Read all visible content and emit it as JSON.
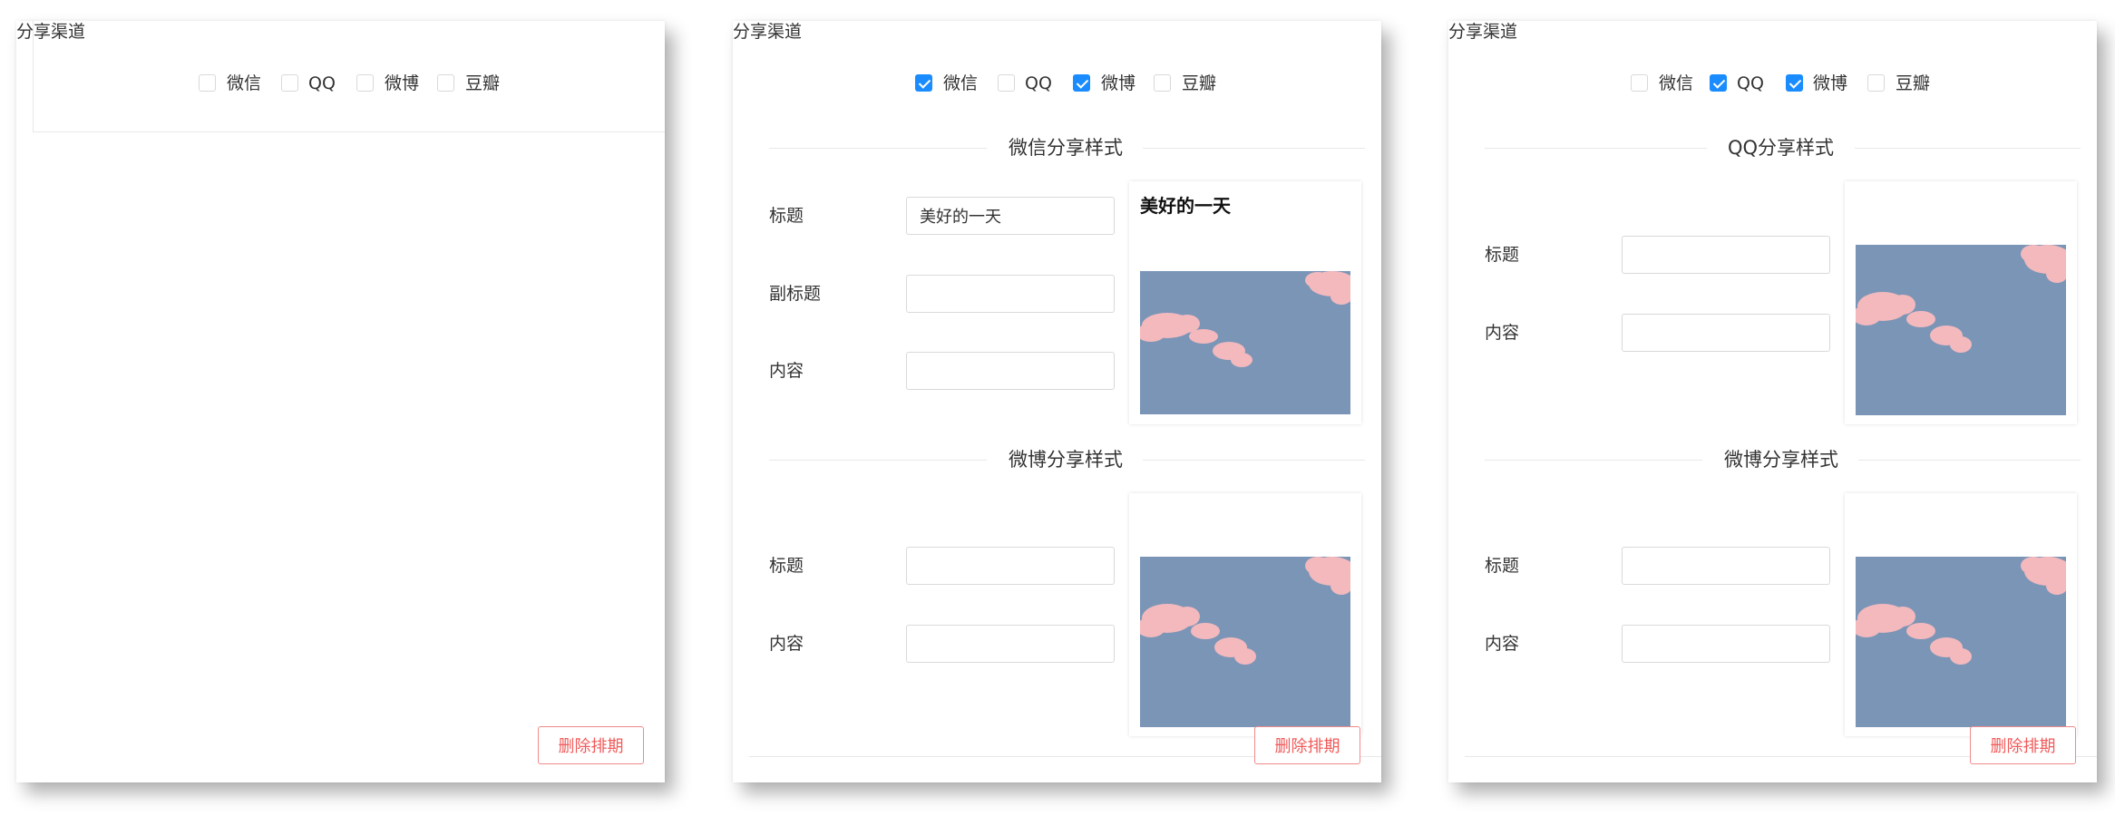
{
  "cards": [
    {
      "channel_label": "分享渠道",
      "channels": [
        {
          "label": "微信",
          "checked": false
        },
        {
          "label": "QQ",
          "checked": false
        },
        {
          "label": "微博",
          "checked": false
        },
        {
          "label": "豆瓣",
          "checked": false
        }
      ],
      "delete_label": "删除排期"
    },
    {
      "channel_label": "分享渠道",
      "channels": [
        {
          "label": "微信",
          "checked": true
        },
        {
          "label": "QQ",
          "checked": false
        },
        {
          "label": "微博",
          "checked": true
        },
        {
          "label": "豆瓣",
          "checked": false
        }
      ],
      "sections": [
        {
          "title": "微信分享样式",
          "fields": [
            {
              "label": "标题",
              "value": "美好的一天"
            },
            {
              "label": "副标题",
              "value": ""
            },
            {
              "label": "内容",
              "value": ""
            }
          ],
          "preview_title": "美好的一天"
        },
        {
          "title": "微博分享样式",
          "fields": [
            {
              "label": "标题",
              "value": ""
            },
            {
              "label": "内容",
              "value": ""
            }
          ]
        }
      ],
      "delete_label": "删除排期"
    },
    {
      "channel_label": "分享渠道",
      "channels": [
        {
          "label": "微信",
          "checked": false
        },
        {
          "label": "QQ",
          "checked": true
        },
        {
          "label": "微博",
          "checked": true
        },
        {
          "label": "豆瓣",
          "checked": false
        }
      ],
      "sections": [
        {
          "title": "QQ分享样式",
          "fields": [
            {
              "label": "标题",
              "value": ""
            },
            {
              "label": "内容",
              "value": ""
            }
          ]
        },
        {
          "title": "微博分享样式",
          "fields": [
            {
              "label": "标题",
              "value": ""
            },
            {
              "label": "内容",
              "value": ""
            }
          ]
        }
      ],
      "delete_label": "删除排期"
    }
  ],
  "colors": {
    "checkbox_checked": "#1a8cff",
    "danger": "#f05a5a",
    "sky": "#7b95b7",
    "cloud": "#f3b9bd"
  },
  "icons": [
    "checkmark-icon"
  ]
}
